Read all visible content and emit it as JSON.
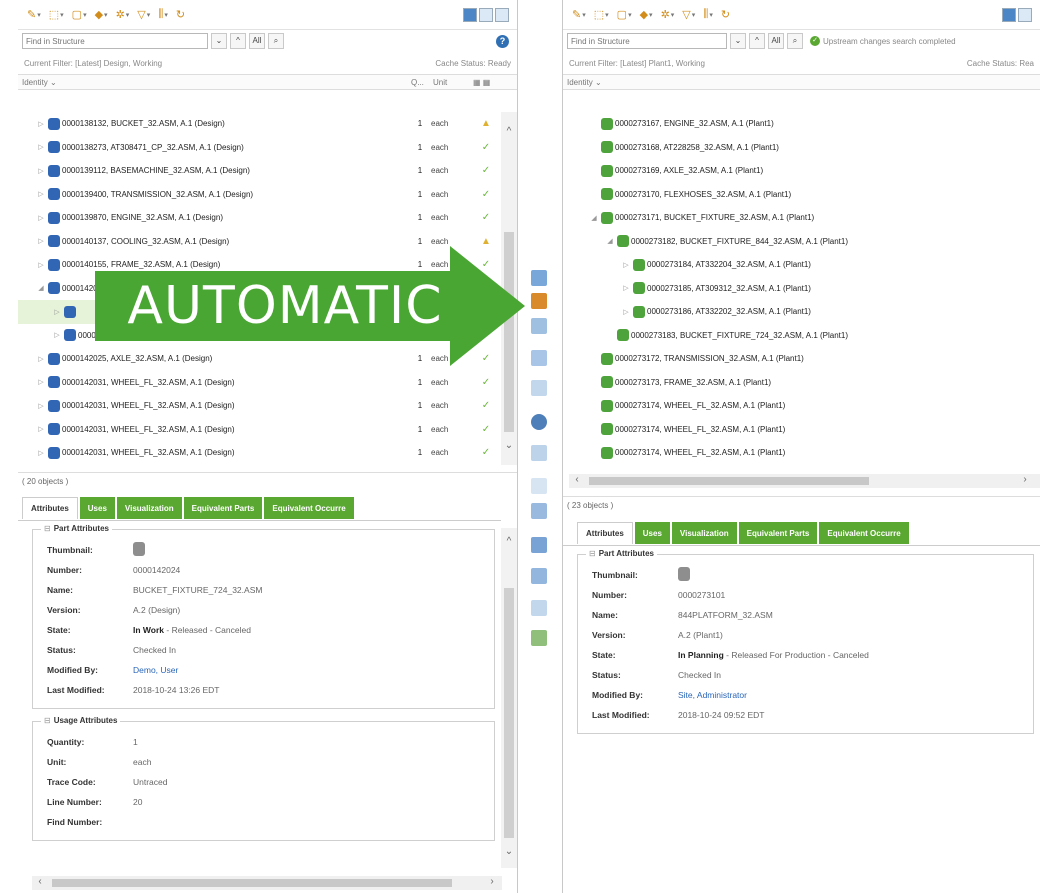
{
  "left": {
    "find_placeholder": "Find in Structure",
    "all_label": "All",
    "filter_text": "Current Filter: [Latest] Design, Working",
    "cache_status": "Cache Status: Ready",
    "columns": {
      "identity": "Identity ⌄",
      "qty": "Q...",
      "unit": "Unit"
    },
    "rows": [
      {
        "label": "0000138132, BUCKET_32.ASM, A.1 (Design)",
        "q": "1",
        "u": "each",
        "st": "warn"
      },
      {
        "label": "0000138273, AT308471_CP_32.ASM, A.1 (Design)",
        "q": "1",
        "u": "each",
        "st": "ok"
      },
      {
        "label": "0000139112, BASEMACHINE_32.ASM, A.1 (Design)",
        "q": "1",
        "u": "each",
        "st": "ok"
      },
      {
        "label": "0000139400, TRANSMISSION_32.ASM, A.1 (Design)",
        "q": "1",
        "u": "each",
        "st": "ok"
      },
      {
        "label": "0000139870, ENGINE_32.ASM, A.1 (Design)",
        "q": "1",
        "u": "each",
        "st": "ok"
      },
      {
        "label": "0000140137, COOLING_32.ASM, A.1 (Design)",
        "q": "1",
        "u": "each",
        "st": "warn"
      },
      {
        "label": "0000140155, FRAME_32.ASM, A.1 (Design)",
        "q": "1",
        "u": "each",
        "st": "ok"
      },
      {
        "label": "0000142024",
        "q": "",
        "u": "",
        "st": ""
      },
      {
        "label": "",
        "q": "",
        "u": "",
        "st": ""
      },
      {
        "label": "0000142026, BUCKET_FIXTURE_844_32.ASM, A.1 (D",
        "q": "1",
        "u": "each",
        "st": ""
      },
      {
        "label": "0000142025, AXLE_32.ASM, A.1 (Design)",
        "q": "1",
        "u": "each",
        "st": "ok"
      },
      {
        "label": "0000142031, WHEEL_FL_32.ASM, A.1 (Design)",
        "q": "1",
        "u": "each",
        "st": "ok"
      },
      {
        "label": "0000142031, WHEEL_FL_32.ASM, A.1 (Design)",
        "q": "1",
        "u": "each",
        "st": "ok"
      },
      {
        "label": "0000142031, WHEEL_FL_32.ASM, A.1 (Design)",
        "q": "1",
        "u": "each",
        "st": "ok"
      },
      {
        "label": "0000142031, WHEEL_FL_32.ASM, A.1 (Design)",
        "q": "1",
        "u": "each",
        "st": "ok"
      }
    ],
    "count": "( 20 objects )",
    "tabs": [
      "Attributes",
      "Uses",
      "Visualization",
      "Equivalent Parts",
      "Equivalent Occurre"
    ],
    "part_attributes_title": "Part Attributes",
    "attrs": [
      {
        "k": "Thumbnail:",
        "v": ""
      },
      {
        "k": "Number:",
        "v": "0000142024"
      },
      {
        "k": "Name:",
        "v": "BUCKET_FIXTURE_724_32.ASM"
      },
      {
        "k": "Version:",
        "v": "A.2 (Design)"
      },
      {
        "k": "State:",
        "v_bold": "In Work",
        "v": " - Released - Canceled"
      },
      {
        "k": "Status:",
        "v": "Checked In"
      },
      {
        "k": "Modified By:",
        "v": "Demo, User"
      },
      {
        "k": "Last Modified:",
        "v": "2018-10-24 13:26 EDT"
      }
    ],
    "usage_attributes_title": "Usage Attributes",
    "usage": [
      {
        "k": "Quantity:",
        "v": "1"
      },
      {
        "k": "Unit:",
        "v": "each"
      },
      {
        "k": "Trace Code:",
        "v": "Untraced"
      },
      {
        "k": "Line Number:",
        "v": "20"
      },
      {
        "k": "Find Number:",
        "v": ""
      }
    ]
  },
  "right": {
    "find_placeholder": "Find in Structure",
    "all_label": "All",
    "search_status": "Upstream changes search completed",
    "filter_text": "Current Filter: [Latest] Plant1, Working",
    "cache_status": "Cache Status: Rea",
    "columns": {
      "identity": "Identity ⌄"
    },
    "rows": [
      {
        "label": "0000273167, ENGINE_32.ASM, A.1 (Plant1)",
        "indent": 1
      },
      {
        "label": "0000273168, AT228258_32.ASM, A.1 (Plant1)",
        "indent": 1
      },
      {
        "label": "0000273169, AXLE_32.ASM, A.1 (Plant1)",
        "indent": 1
      },
      {
        "label": "0000273170, FLEXHOSES_32.ASM, A.1 (Plant1)",
        "indent": 1
      },
      {
        "label": "0000273171, BUCKET_FIXTURE_32.ASM, A.1 (Plant1)",
        "indent": 1
      },
      {
        "label": "0000273182, BUCKET_FIXTURE_844_32.ASM, A.1 (Plant1)",
        "indent": 2
      },
      {
        "label": "0000273184, AT332204_32.ASM, A.1 (Plant1)",
        "indent": 3
      },
      {
        "label": "0000273185, AT309312_32.ASM, A.1 (Plant1)",
        "indent": 3
      },
      {
        "label": "0000273186, AT332202_32.ASM, A.1 (Plant1)",
        "indent": 3
      },
      {
        "label": "0000273183, BUCKET_FIXTURE_724_32.ASM, A.1 (Plant1)",
        "indent": 2
      },
      {
        "label": "0000273172, TRANSMISSION_32.ASM, A.1 (Plant1)",
        "indent": 1
      },
      {
        "label": "0000273173, FRAME_32.ASM, A.1 (Plant1)",
        "indent": 1
      },
      {
        "label": "0000273174, WHEEL_FL_32.ASM, A.1 (Plant1)",
        "indent": 1
      },
      {
        "label": "0000273174, WHEEL_FL_32.ASM, A.1 (Plant1)",
        "indent": 1
      },
      {
        "label": "0000273174, WHEEL_FL_32.ASM, A.1 (Plant1)",
        "indent": 1
      }
    ],
    "count": "( 23 objects )",
    "tabs": [
      "Attributes",
      "Uses",
      "Visualization",
      "Equivalent Parts",
      "Equivalent Occurre"
    ],
    "part_attributes_title": "Part Attributes",
    "attrs": [
      {
        "k": "Thumbnail:",
        "v": ""
      },
      {
        "k": "Number:",
        "v": "0000273101"
      },
      {
        "k": "Name:",
        "v": "844PLATFORM_32.ASM"
      },
      {
        "k": "Version:",
        "v": "A.2 (Plant1)"
      },
      {
        "k": "State:",
        "v_bold": "In Planning",
        "v": " - Released For Production - Canceled"
      },
      {
        "k": "Status:",
        "v": "Checked In"
      },
      {
        "k": "Modified By:",
        "v": "Site, Administrator"
      },
      {
        "k": "Last Modified:",
        "v": "2018-10-24 09:52 EDT"
      }
    ]
  },
  "overlay": {
    "text": "AUTOMATIC",
    "color": "#4aa632"
  },
  "colors": {
    "accent_green": "#5aa832",
    "design_icon": "#3166b5",
    "plant_icon": "#4ea33c"
  }
}
